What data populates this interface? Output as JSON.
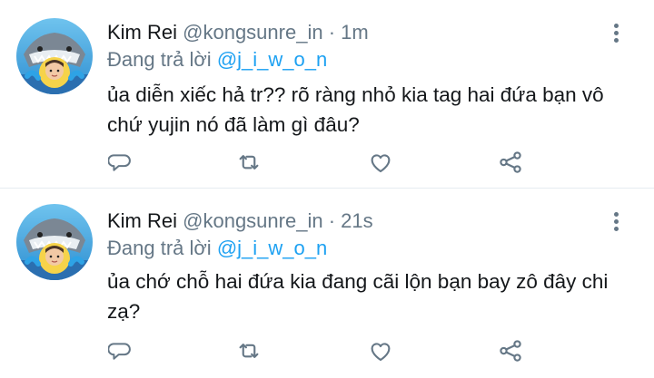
{
  "tweets": [
    {
      "name": "Kim Rei",
      "handle": "@kongsunre_in",
      "separator": "·",
      "time": "1m",
      "reply_prefix": "Đang trả lời",
      "reply_mention": "@j_i_w_o_n",
      "text": "ủa diễn xiếc hả tr?? rõ ràng nhỏ kia tag hai đứa bạn vô chứ yujin nó đã làm gì đâu?"
    },
    {
      "name": "Kim Rei",
      "handle": "@kongsunre_in",
      "separator": "·",
      "time": "21s",
      "reply_prefix": "Đang trả lời",
      "reply_mention": "@j_i_w_o_n",
      "text": "ủa chớ chỗ hai đứa kia đang cãi lộn bạn bay zô đây chi zạ?"
    }
  ],
  "icons": {
    "reply": "reply-icon",
    "retweet": "retweet-icon",
    "like": "like-icon",
    "share": "share-icon",
    "more": "more-vertical-icon"
  },
  "colors": {
    "text": "#14171a",
    "secondary": "#657786",
    "link": "#1da1f2",
    "divider": "#e6ecf0"
  }
}
